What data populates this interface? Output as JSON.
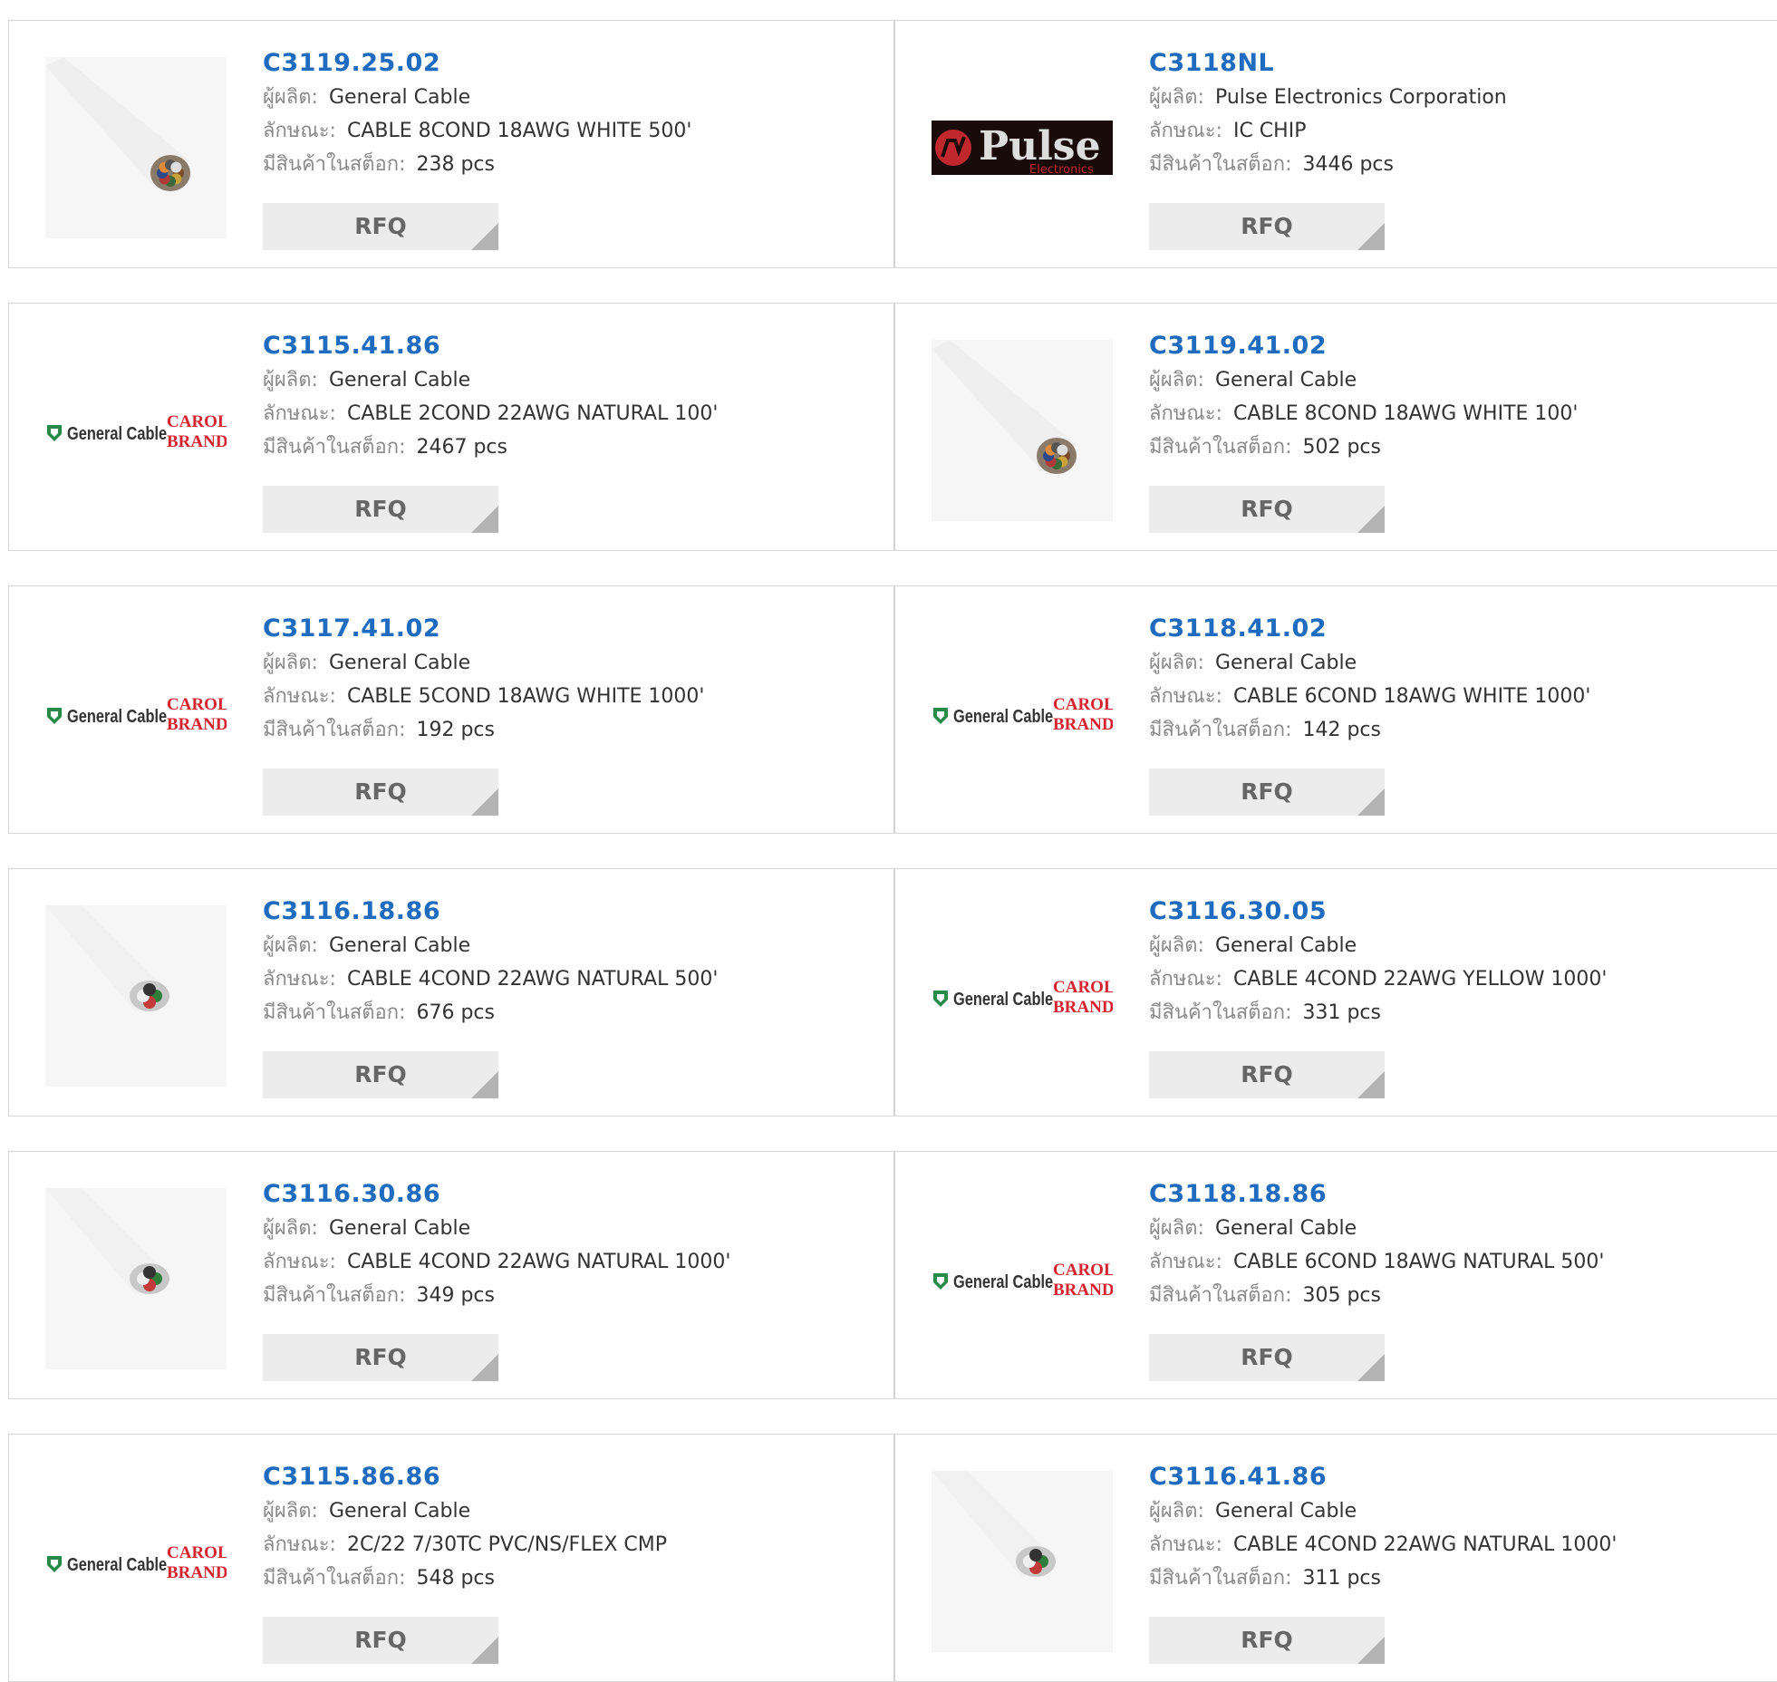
{
  "labels": {
    "manufacturer": "ผู้ผลิต:",
    "description": "ลักษณะ:",
    "stock": "มีสินค้าในสต็อก:",
    "rfq": "RFQ"
  },
  "products": [
    {
      "part": "C3119.25.02",
      "manufacturer": "General Cable",
      "description": "CABLE 8COND 18AWG WHITE 500'",
      "stock": "238 pcs",
      "image": "cable-photo-8cond"
    },
    {
      "part": "C3118NL",
      "manufacturer": "Pulse Electronics Corporation",
      "description": "IC CHIP",
      "stock": "3446 pcs",
      "image": "pulse-logo"
    },
    {
      "part": "C3115.41.86",
      "manufacturer": "General Cable",
      "description": "CABLE 2COND 22AWG NATURAL 100'",
      "stock": "2467 pcs",
      "image": "general-cable-logo"
    },
    {
      "part": "C3119.41.02",
      "manufacturer": "General Cable",
      "description": "CABLE 8COND 18AWG WHITE 100'",
      "stock": "502 pcs",
      "image": "cable-photo-8cond"
    },
    {
      "part": "C3117.41.02",
      "manufacturer": "General Cable",
      "description": "CABLE 5COND 18AWG WHITE 1000'",
      "stock": "192 pcs",
      "image": "general-cable-logo"
    },
    {
      "part": "C3118.41.02",
      "manufacturer": "General Cable",
      "description": "CABLE 6COND 18AWG WHITE 1000'",
      "stock": "142 pcs",
      "image": "general-cable-logo"
    },
    {
      "part": "C3116.18.86",
      "manufacturer": "General Cable",
      "description": "CABLE 4COND 22AWG NATURAL 500'",
      "stock": "676 pcs",
      "image": "cable-photo-4cond"
    },
    {
      "part": "C3116.30.05",
      "manufacturer": "General Cable",
      "description": "CABLE 4COND 22AWG YELLOW 1000'",
      "stock": "331 pcs",
      "image": "general-cable-logo"
    },
    {
      "part": "C3116.30.86",
      "manufacturer": "General Cable",
      "description": "CABLE 4COND 22AWG NATURAL 1000'",
      "stock": "349 pcs",
      "image": "cable-photo-4cond"
    },
    {
      "part": "C3118.18.86",
      "manufacturer": "General Cable",
      "description": "CABLE 6COND 18AWG NATURAL 500'",
      "stock": "305 pcs",
      "image": "general-cable-logo"
    },
    {
      "part": "C3115.86.86",
      "manufacturer": "General Cable",
      "description": "2C/22 7/30TC PVC/NS/FLEX CMP",
      "stock": "548 pcs",
      "image": "general-cable-logo"
    },
    {
      "part": "C3116.41.86",
      "manufacturer": "General Cable",
      "description": "CABLE 4COND 22AWG NATURAL 1000'",
      "stock": "311 pcs",
      "image": "cable-photo-4cond"
    }
  ],
  "logos": {
    "general_cable": "General Cable",
    "carol": "CAROL",
    "brand": "BRAND",
    "pulse": "Pulse",
    "pulse_sub": "Electronics"
  },
  "colors": {
    "part_link": "#1e6bbf",
    "rfq_bg": "#ececec",
    "border": "#d6d6d6",
    "carol_red": "#d9232e",
    "pulse_bg": "#1a0b0b"
  }
}
